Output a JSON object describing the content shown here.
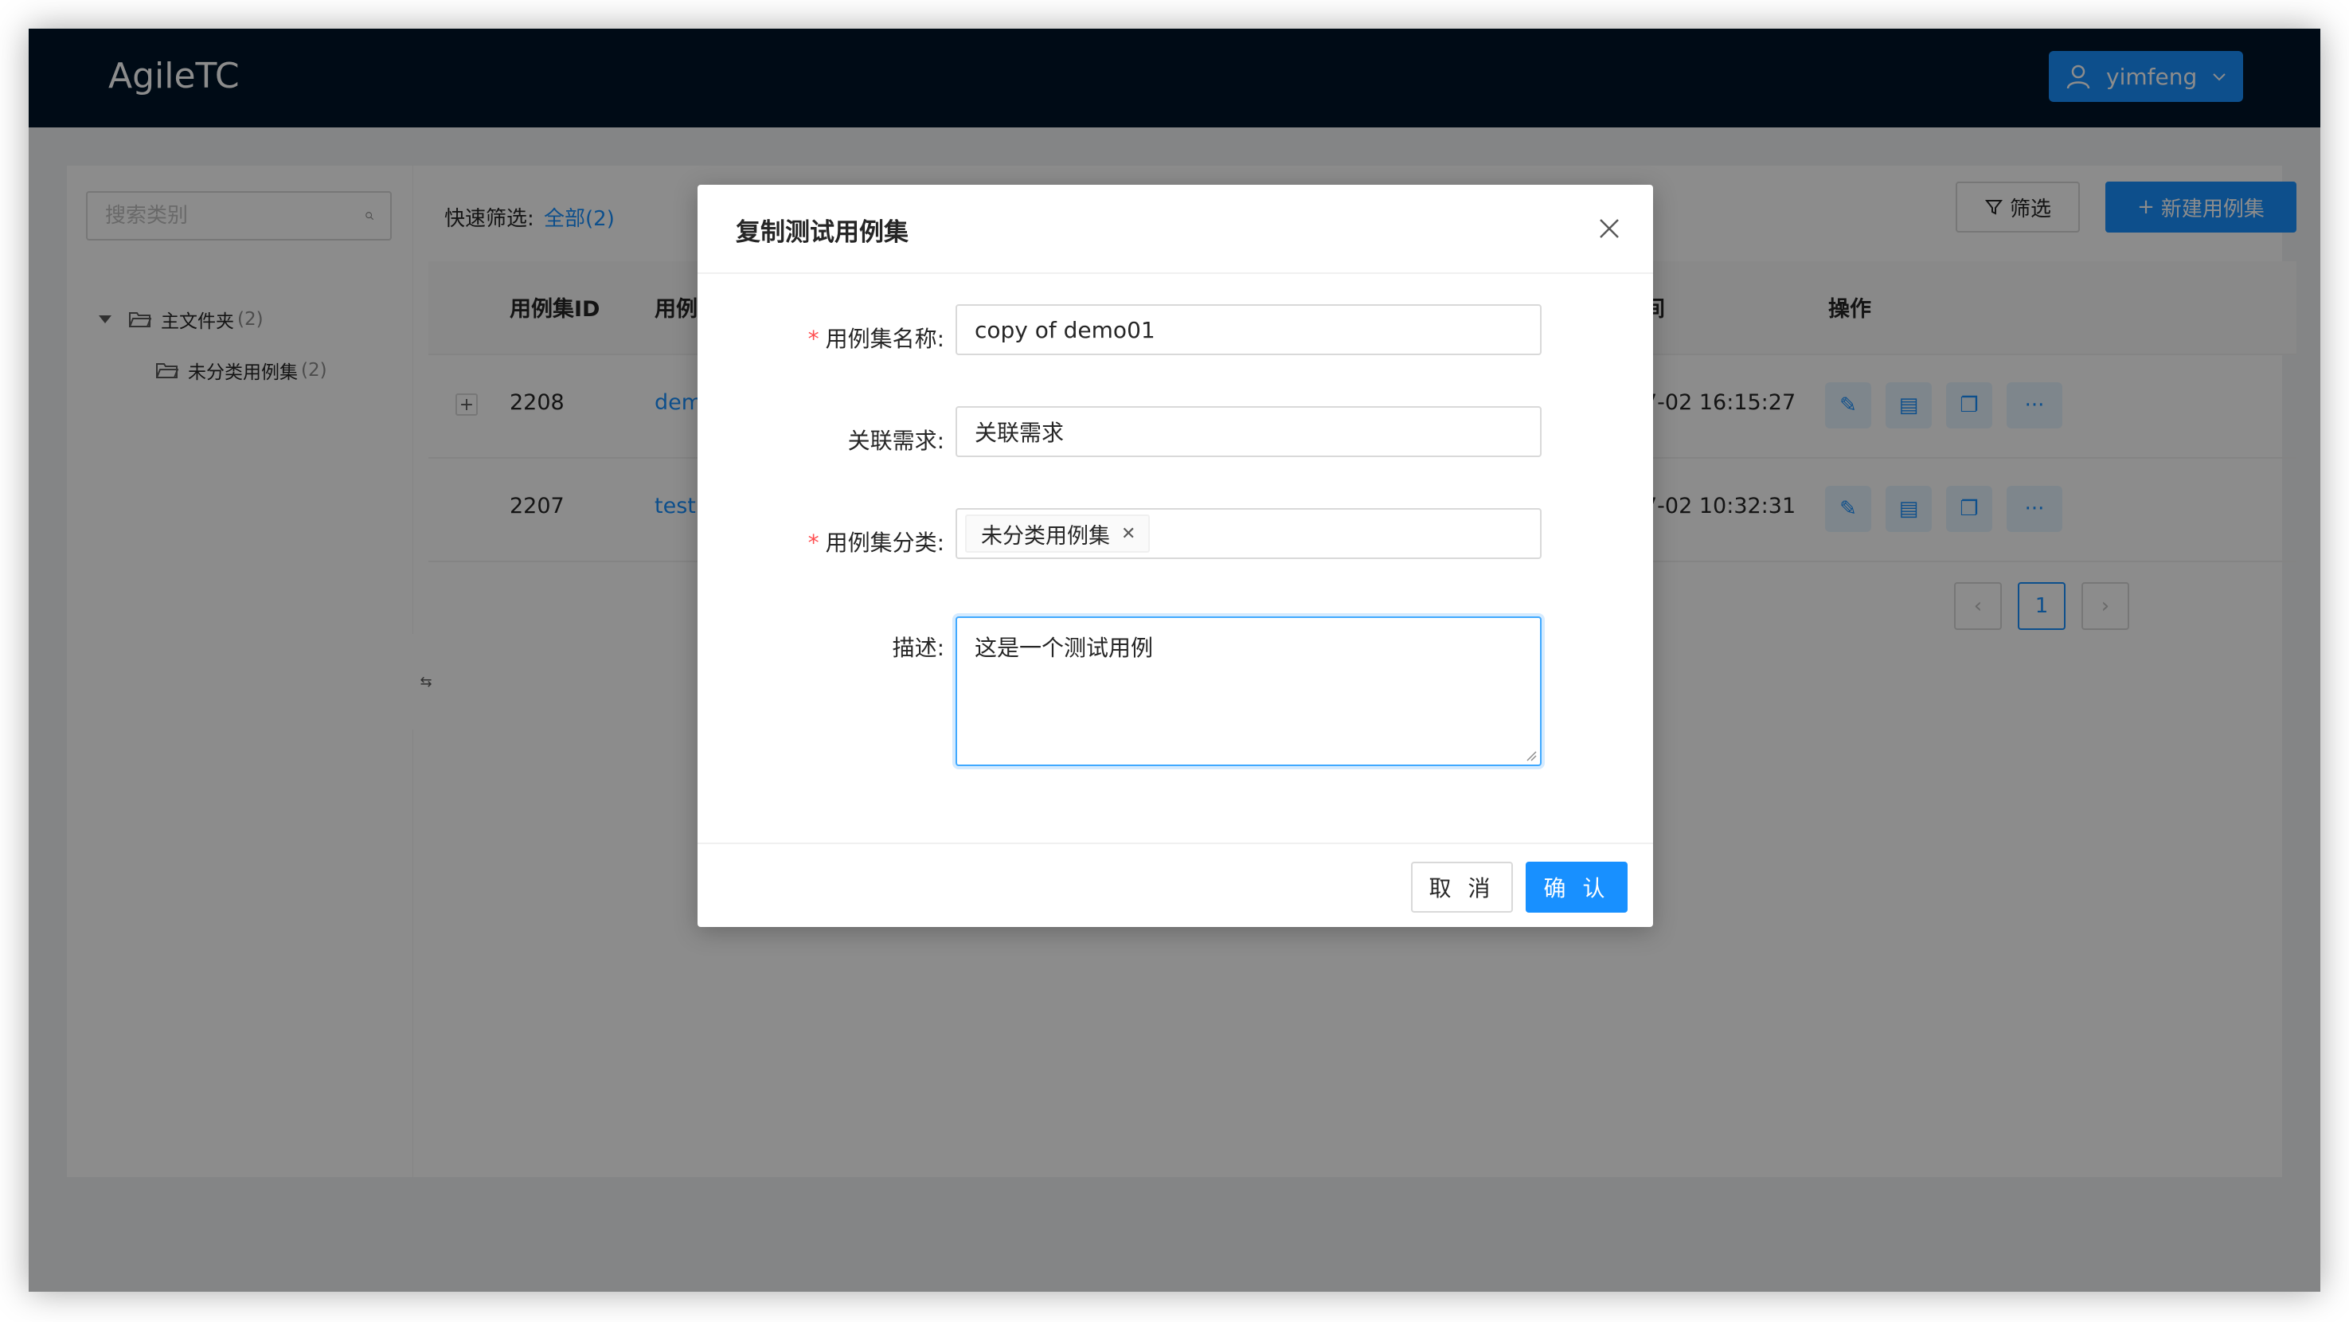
{
  "app": {
    "title": "AgileTC"
  },
  "user": {
    "name": "yimfeng"
  },
  "sidebar": {
    "search_placeholder": "搜索类别",
    "tree": [
      {
        "label": "主文件夹",
        "count": "(2)"
      },
      {
        "label": "未分类用例集",
        "count": "(2)"
      }
    ]
  },
  "toolbar": {
    "quick_filter_label": "快速筛选:",
    "quick_filter_value": "全部(2)",
    "filter_button": "筛选",
    "new_button": "新建用例集"
  },
  "table": {
    "headers": {
      "id": "用例集ID",
      "name": "用例",
      "time": "间",
      "ops": "操作"
    },
    "rows": [
      {
        "id": "2208",
        "name": "dem",
        "time": "7-02 16:15:27"
      },
      {
        "id": "2207",
        "name": "test",
        "time": "7-02 10:32:31"
      }
    ]
  },
  "pagination": {
    "current": "1"
  },
  "modal": {
    "title": "复制测试用例集",
    "fields": {
      "name": {
        "label": "用例集名称:",
        "value": "copy of demo01"
      },
      "requirement": {
        "label": "关联需求:",
        "placeholder": "关联需求"
      },
      "category": {
        "label": "用例集分类:",
        "tag": "未分类用例集"
      },
      "description": {
        "label": "描述:",
        "value": "这是一个测试用例"
      }
    },
    "cancel_label": "取 消",
    "ok_label": "确 认"
  },
  "colors": {
    "primary": "#1890ff",
    "header": "#001529",
    "required": "#ff4d4f"
  }
}
